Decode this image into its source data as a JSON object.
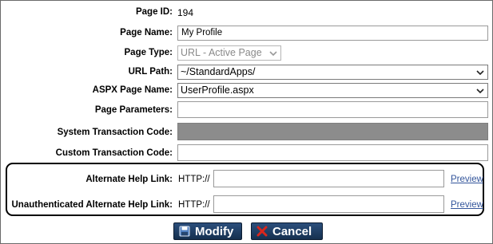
{
  "form": {
    "page_id_label": "Page ID:",
    "page_id_value": "194",
    "page_name_label": "Page Name:",
    "page_name_value": "My Profile",
    "page_type_label": "Page Type:",
    "page_type_value": "URL - Active Page",
    "url_path_label": "URL Path:",
    "url_path_value": "~/StandardApps/",
    "aspx_label": "ASPX Page Name:",
    "aspx_value": "UserProfile.aspx",
    "params_label": "Page Parameters:",
    "params_value": "",
    "system_tc_label": "System Transaction Code:",
    "custom_tc_label": "Custom Transaction Code:",
    "custom_tc_value": ""
  },
  "help": {
    "alt_label": "Alternate Help Link:",
    "alt_prefix": "HTTP://",
    "alt_value": "",
    "alt_preview": "Preview",
    "unauth_label": "Unauthenticated Alternate Help Link:",
    "unauth_prefix": "HTTP://",
    "unauth_value": "",
    "unauth_preview": "Preview"
  },
  "buttons": {
    "modify_label": "Modify",
    "cancel_label": "Cancel"
  },
  "icons": {
    "modify_icon": "save-disk-icon",
    "cancel_icon": "red-x-icon",
    "dropdown_icon": "chevron-down-icon"
  },
  "colors": {
    "button_bg": "#1f3d63",
    "link": "#33559b",
    "disabled_field": "#8c8c8c",
    "cancel_x": "#d9261c"
  }
}
